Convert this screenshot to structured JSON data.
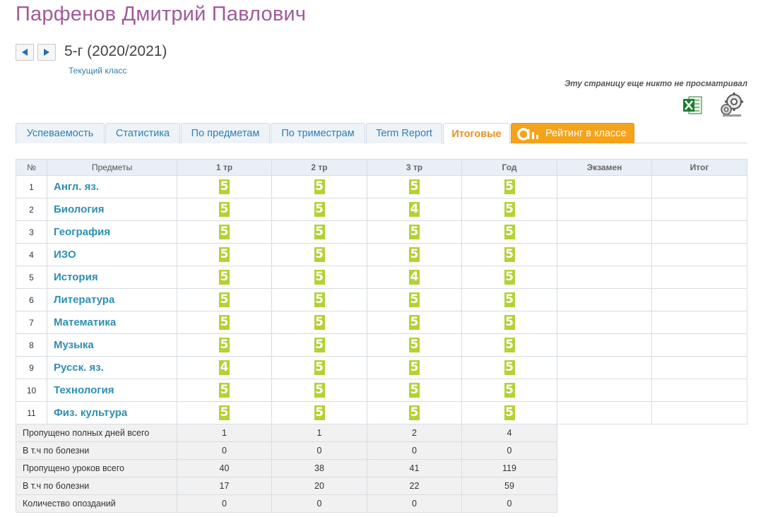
{
  "student": {
    "name": "Парфенов Дмитрий Павлович"
  },
  "class_nav": {
    "label": "5-г (2020/2021)",
    "current_class_link": "Текущий класс"
  },
  "viewed_note": "Эту страницу еще никто не просматривал",
  "tabs": [
    {
      "label": "Успеваемость"
    },
    {
      "label": "Статистика"
    },
    {
      "label": "По предметам"
    },
    {
      "label": "По триместрам"
    },
    {
      "label": "Term Report"
    },
    {
      "label": "Итоговые"
    },
    {
      "label": "Рейтинг в классе"
    }
  ],
  "active_tab": "Итоговые",
  "table": {
    "headers": [
      "№",
      "Предметы",
      "1 тр",
      "2 тр",
      "3 тр",
      "Год",
      "Экзамен",
      "Итог"
    ],
    "rows": [
      {
        "n": "1",
        "subject": "Англ. яз.",
        "t1": "5",
        "t2": "5",
        "t3": "5",
        "year": "5"
      },
      {
        "n": "2",
        "subject": "Биология",
        "t1": "5",
        "t2": "5",
        "t3": "4",
        "year": "5"
      },
      {
        "n": "3",
        "subject": "География",
        "t1": "5",
        "t2": "5",
        "t3": "5",
        "year": "5"
      },
      {
        "n": "4",
        "subject": "ИЗО",
        "t1": "5",
        "t2": "5",
        "t3": "5",
        "year": "5"
      },
      {
        "n": "5",
        "subject": "История",
        "t1": "5",
        "t2": "5",
        "t3": "4",
        "year": "5"
      },
      {
        "n": "6",
        "subject": "Литература",
        "t1": "5",
        "t2": "5",
        "t3": "5",
        "year": "5"
      },
      {
        "n": "7",
        "subject": "Математика",
        "t1": "5",
        "t2": "5",
        "t3": "5",
        "year": "5"
      },
      {
        "n": "8",
        "subject": "Музыка",
        "t1": "5",
        "t2": "5",
        "t3": "5",
        "year": "5"
      },
      {
        "n": "9",
        "subject": "Русск. яз.",
        "t1": "4",
        "t2": "5",
        "t3": "5",
        "year": "5"
      },
      {
        "n": "10",
        "subject": "Технология",
        "t1": "5",
        "t2": "5",
        "t3": "5",
        "year": "5"
      },
      {
        "n": "11",
        "subject": "Физ. культура",
        "t1": "5",
        "t2": "5",
        "t3": "5",
        "year": "5"
      }
    ],
    "stats": [
      {
        "label": "Пропущено полных дней всего",
        "t1": "1",
        "t2": "1",
        "t3": "2",
        "year": "4"
      },
      {
        "label": "В т.ч по болезни",
        "t1": "0",
        "t2": "0",
        "t3": "0",
        "year": "0"
      },
      {
        "label": "Пропущено уроков всего",
        "t1": "40",
        "t2": "38",
        "t3": "41",
        "year": "119"
      },
      {
        "label": "В т.ч по болезни",
        "t1": "17",
        "t2": "20",
        "t3": "22",
        "year": "59"
      },
      {
        "label": "Количество опозданий",
        "t1": "0",
        "t2": "0",
        "t3": "0",
        "year": "0"
      }
    ]
  },
  "colors": {
    "name": "#a05a9b",
    "link": "#2d8fb3",
    "mark_bg": "#b3d235",
    "active_tab": "#e8921f",
    "rating_tab": "#f5a31a"
  },
  "icons": [
    "prev-arrow-icon",
    "next-arrow-icon",
    "excel-icon",
    "settings-icon",
    "rating-logo-icon"
  ]
}
